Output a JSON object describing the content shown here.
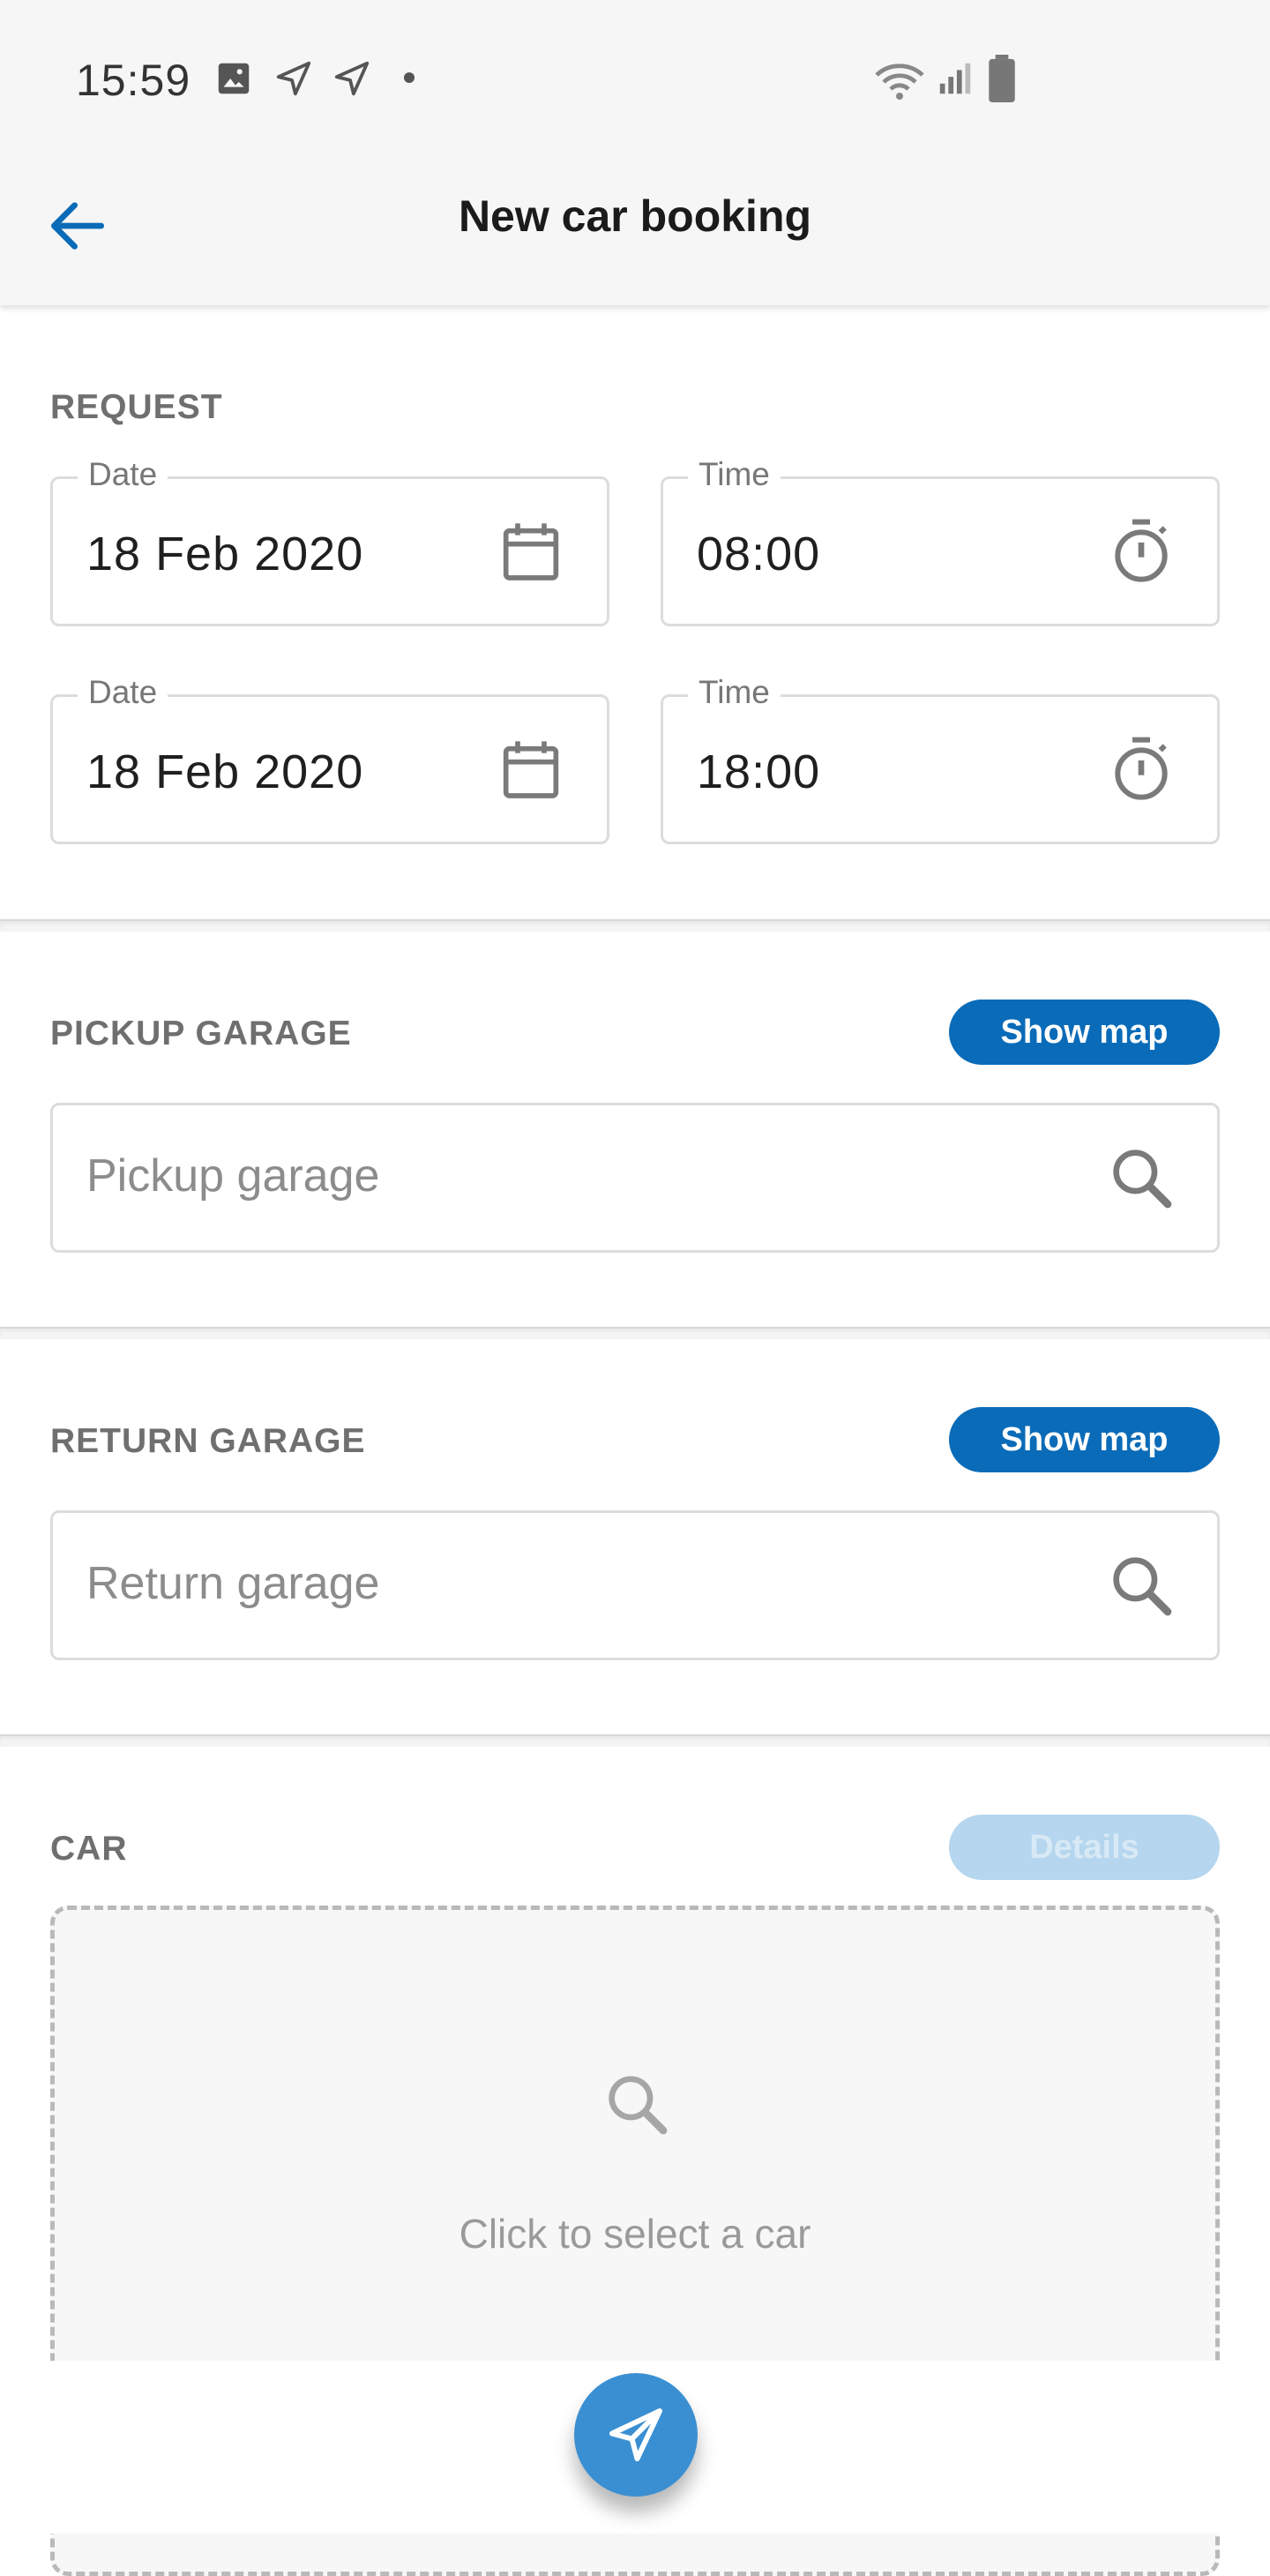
{
  "status_bar": {
    "time": "15:59"
  },
  "app_bar": {
    "title": "New car booking"
  },
  "request": {
    "heading": "REQUEST",
    "rows": [
      {
        "date_label": "Date",
        "date_value": "18 Feb 2020",
        "time_label": "Time",
        "time_value": "08:00"
      },
      {
        "date_label": "Date",
        "date_value": "18 Feb 2020",
        "time_label": "Time",
        "time_value": "18:00"
      }
    ]
  },
  "pickup": {
    "heading": "PICKUP GARAGE",
    "button": "Show map",
    "placeholder": "Pickup garage"
  },
  "return": {
    "heading": "RETURN GARAGE",
    "button": "Show map",
    "placeholder": "Return garage"
  },
  "car": {
    "heading": "CAR",
    "button": "Details",
    "prompt": "Click to select a car"
  },
  "colors": {
    "accent": "#0a6bb8",
    "fab": "#3a8fd2",
    "disabled_pill": "#b5d6ee"
  }
}
